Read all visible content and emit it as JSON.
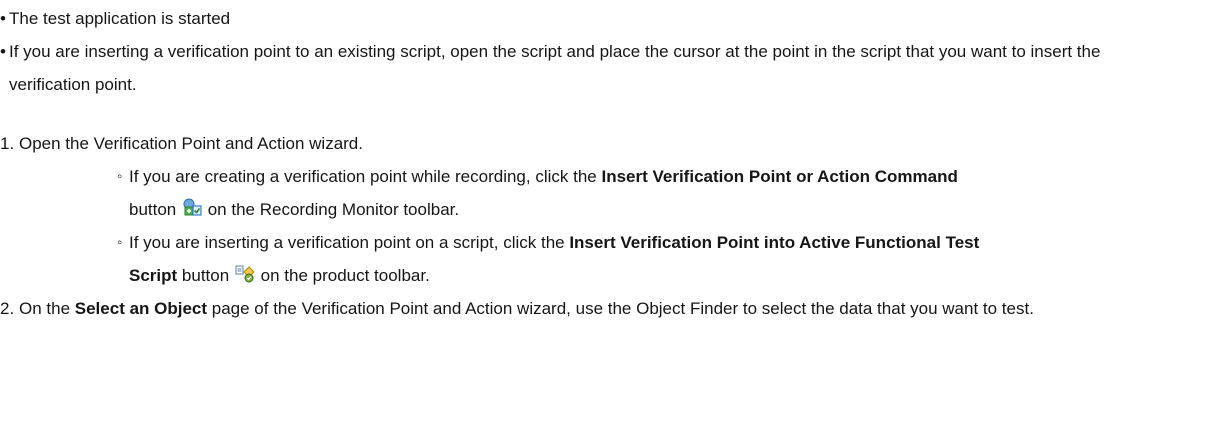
{
  "prerequisites": [
    "The test application is started",
    "If you are inserting a verification point to an existing script, open the script and place the cursor at the point in the script that you want to insert the verification point."
  ],
  "steps": {
    "s1_num": "1.",
    "s1_text": "Open the Verification Point and Action wizard.",
    "sub1_pre": "If you are creating a verification point while recording, click the ",
    "sub1_bold": "Insert Verification Point or Action Command",
    "sub1_mid": " button ",
    "sub1_post": " on the Recording Monitor toolbar.",
    "sub2_pre": "If you are inserting a verification point on a script, click the ",
    "sub2_bold": "Insert Verification Point into Active Functional Test Script",
    "sub2_mid": " button ",
    "sub2_post": " on the product toolbar.",
    "s2_num": "2.",
    "s2_pre": "On the ",
    "s2_bold": "Select an Object",
    "s2_post": " page of the Verification Point and Action wizard, use the Object Finder to select the data that you want to test."
  },
  "icons": {
    "recording_icon": "insert-verification-point-action-icon",
    "product_icon": "insert-verification-point-script-icon"
  }
}
